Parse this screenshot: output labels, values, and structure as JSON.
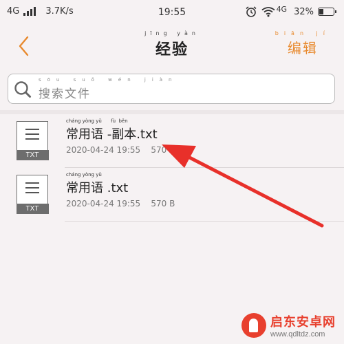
{
  "status_bar": {
    "network": "4G",
    "speed": "3.7K/s",
    "time": "19:55",
    "wifi_network": "4G",
    "battery": "32%",
    "battery_level": 0.32
  },
  "header": {
    "title_pinyin": "jīng yàn",
    "title": "经验",
    "edit_pinyin": "biān jí",
    "edit_label": "编辑"
  },
  "search": {
    "pinyin": "sōu suǒ wén jiàn",
    "placeholder": "搜索文件"
  },
  "files": [
    {
      "name_pinyin": "cháng yòng yǔ      fù  běn",
      "name": "常用语 -副本.txt",
      "date": "2020-04-24 19:55",
      "size": "570 B",
      "type": "TXT"
    },
    {
      "name_pinyin": "cháng yòng yǔ",
      "name": "常用语 .txt",
      "date": "2020-04-24 19:55",
      "size": "570 B",
      "type": "TXT"
    }
  ],
  "watermark": {
    "title": "启东安卓网",
    "url": "www.qdltdz.com"
  },
  "colors": {
    "accent": "#e88a2e",
    "arrow": "#e8302a",
    "background": "#f6f2f3"
  },
  "icons": {
    "back": "chevron-left-icon",
    "search": "search-icon",
    "file": "txt-file-icon",
    "wifi": "wifi-icon",
    "alarm": "alarm-icon"
  }
}
